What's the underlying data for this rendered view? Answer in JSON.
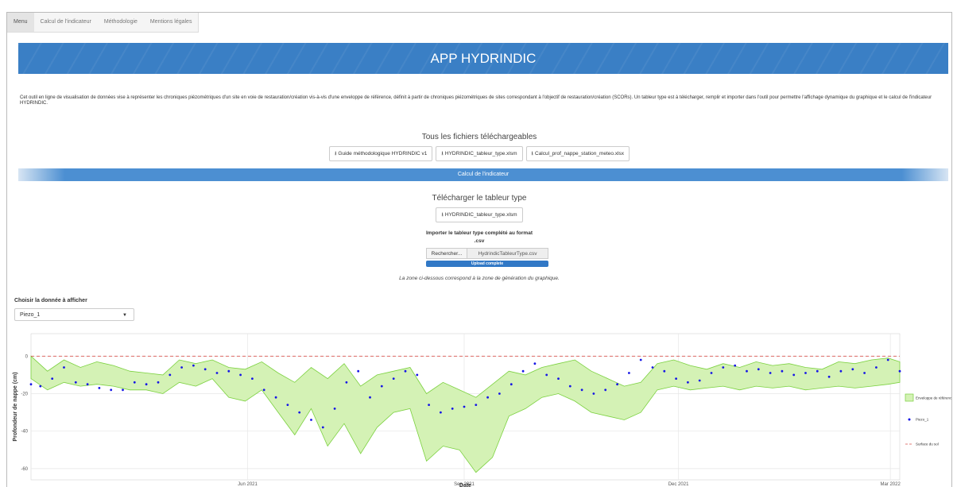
{
  "nav": {
    "tabs": [
      "Menu",
      "Calcul de l'indicateur",
      "Méthodologie",
      "Mentions légales"
    ]
  },
  "banner": {
    "title": "APP HYDRINDIC"
  },
  "intro": {
    "text": "Cet outil en ligne de visualisation de données vise à représenter les chroniques piézométriques d'un site en voie de restauration/création vis-à-vis d'une enveloppe de référence, définit à partir de chroniques piézométriques de sites correspondant à l'objectif de restauration/création (SCORs). Un tableur type est à télécharger, remplir et importer dans l'outil pour permettre l'affichage dynamique du graphique et le calcul de l'indicateur HYDRINDIC."
  },
  "downloads": {
    "heading": "Tous les fichiers téléchargeables",
    "buttons": [
      "Guide méthodologique HYDRINDIC v1",
      "HYDRINDIC_tableur_type.xlsm",
      "Calcul_prof_nappe_station_meteo.xlsx"
    ]
  },
  "section": {
    "title": "Calcul de l'indicateur"
  },
  "template": {
    "heading": "Télécharger le tableur type",
    "button": "HYDRINDIC_tableur_type.xlsm"
  },
  "upload": {
    "label_line1": "Importer le tableur type complété au format",
    "label_line2": ".csv",
    "browse": "Rechercher...",
    "filename": "HydrindicTableurType.csv",
    "status": "Upload complete",
    "progress": 1.0
  },
  "note": "La zone ci-dessous correspond à la zone de génération du graphique.",
  "selector": {
    "label": "Choisir la donnée à afficher",
    "value": "Piezo_1"
  },
  "icons": {
    "download": "download-icon",
    "caret": "caret-down-icon"
  },
  "colors": {
    "accent": "#3a7fc5",
    "envelope_fill": "#d4f2b5",
    "envelope_line": "#7bd13f",
    "points": "#1515e6",
    "surface": "#d9534f"
  },
  "chart_data": {
    "type": "line",
    "xlabel": "Date",
    "ylabel": "Profondeur de nappe (cm)",
    "x_ticks": [
      "Jun 2021",
      "Sep 2021",
      "Dec 2021",
      "Mar 2022"
    ],
    "y_ticks": [
      0,
      -20,
      -40,
      -60
    ],
    "ylim": [
      -66,
      12
    ],
    "grid": true,
    "legend_position": "right",
    "legend": [
      "Enveloppe de référence",
      "Piezo_1",
      "Surface du sol"
    ],
    "surface_level": 0,
    "envelope": {
      "x": [
        "2021-03-01",
        "2021-03-08",
        "2021-03-15",
        "2021-03-22",
        "2021-03-29",
        "2021-04-05",
        "2021-04-12",
        "2021-04-19",
        "2021-04-26",
        "2021-05-03",
        "2021-05-10",
        "2021-05-17",
        "2021-05-24",
        "2021-05-31",
        "2021-06-07",
        "2021-06-14",
        "2021-06-21",
        "2021-06-28",
        "2021-07-05",
        "2021-07-12",
        "2021-07-19",
        "2021-07-26",
        "2021-08-02",
        "2021-08-09",
        "2021-08-16",
        "2021-08-23",
        "2021-08-30",
        "2021-09-06",
        "2021-09-13",
        "2021-09-20",
        "2021-09-27",
        "2021-10-04",
        "2021-10-11",
        "2021-10-18",
        "2021-10-25",
        "2021-11-01",
        "2021-11-08",
        "2021-11-15",
        "2021-11-22",
        "2021-11-29",
        "2021-12-06",
        "2021-12-13",
        "2021-12-20",
        "2021-12-27",
        "2022-01-03",
        "2022-01-10",
        "2022-01-17",
        "2022-01-24",
        "2022-01-31",
        "2022-02-07",
        "2022-02-14",
        "2022-02-21",
        "2022-02-28",
        "2022-03-05"
      ],
      "upper": [
        0,
        -8,
        -2,
        -6,
        -3,
        -5,
        -8,
        -9,
        -10,
        -2,
        -4,
        -2,
        -6,
        -7,
        -3,
        -9,
        -14,
        -6,
        -12,
        -4,
        -16,
        -10,
        -8,
        -6,
        -20,
        -14,
        -18,
        -22,
        -15,
        -8,
        -10,
        -6,
        -4,
        -2,
        -8,
        -12,
        -16,
        -14,
        -4,
        -2,
        -5,
        -7,
        -4,
        -6,
        -3,
        -5,
        -4,
        -6,
        -7,
        -3,
        -4,
        -2,
        -1,
        -3
      ],
      "lower": [
        -12,
        -18,
        -14,
        -16,
        -15,
        -16,
        -18,
        -18,
        -20,
        -14,
        -16,
        -12,
        -22,
        -24,
        -18,
        -30,
        -42,
        -28,
        -48,
        -36,
        -52,
        -38,
        -30,
        -28,
        -56,
        -48,
        -50,
        -62,
        -54,
        -32,
        -28,
        -22,
        -20,
        -24,
        -30,
        -32,
        -34,
        -30,
        -18,
        -16,
        -18,
        -17,
        -16,
        -18,
        -16,
        -17,
        -16,
        -18,
        -17,
        -16,
        -17,
        -16,
        -15,
        -14
      ]
    },
    "series": [
      {
        "name": "Piezo_1",
        "x": [
          "2021-03-01",
          "2021-03-05",
          "2021-03-10",
          "2021-03-15",
          "2021-03-20",
          "2021-03-25",
          "2021-03-30",
          "2021-04-04",
          "2021-04-09",
          "2021-04-14",
          "2021-04-19",
          "2021-04-24",
          "2021-04-29",
          "2021-05-04",
          "2021-05-09",
          "2021-05-14",
          "2021-05-19",
          "2021-05-24",
          "2021-05-29",
          "2021-06-03",
          "2021-06-08",
          "2021-06-13",
          "2021-06-18",
          "2021-06-23",
          "2021-06-28",
          "2021-07-03",
          "2021-07-08",
          "2021-07-13",
          "2021-07-18",
          "2021-07-23",
          "2021-07-28",
          "2021-08-02",
          "2021-08-07",
          "2021-08-12",
          "2021-08-17",
          "2021-08-22",
          "2021-08-27",
          "2021-09-01",
          "2021-09-06",
          "2021-09-11",
          "2021-09-16",
          "2021-09-21",
          "2021-09-26",
          "2021-10-01",
          "2021-10-06",
          "2021-10-11",
          "2021-10-16",
          "2021-10-21",
          "2021-10-26",
          "2021-10-31",
          "2021-11-05",
          "2021-11-10",
          "2021-11-15",
          "2021-11-20",
          "2021-11-25",
          "2021-11-30",
          "2021-12-05",
          "2021-12-10",
          "2021-12-15",
          "2021-12-20",
          "2021-12-25",
          "2021-12-30",
          "2022-01-04",
          "2022-01-09",
          "2022-01-14",
          "2022-01-19",
          "2022-01-24",
          "2022-01-29",
          "2022-02-03",
          "2022-02-08",
          "2022-02-13",
          "2022-02-18",
          "2022-02-23",
          "2022-02-28",
          "2022-03-05"
        ],
        "y": [
          -15,
          -16,
          -12,
          -6,
          -14,
          -15,
          -17,
          -18,
          -18,
          -14,
          -15,
          -14,
          -10,
          -6,
          -5,
          -7,
          -9,
          -8,
          -10,
          -12,
          -18,
          -22,
          -26,
          -30,
          -34,
          -38,
          -28,
          -14,
          -8,
          -22,
          -16,
          -12,
          -8,
          -10,
          -26,
          -30,
          -28,
          -27,
          -26,
          -22,
          -20,
          -15,
          -8,
          -4,
          -10,
          -12,
          -16,
          -18,
          -20,
          -18,
          -15,
          -9,
          -2,
          -6,
          -8,
          -12,
          -14,
          -13,
          -9,
          -6,
          -5,
          -8,
          -7,
          -9,
          -8,
          -10,
          -9,
          -8,
          -11,
          -8,
          -7,
          -9,
          -6,
          -2,
          -8
        ]
      }
    ]
  }
}
